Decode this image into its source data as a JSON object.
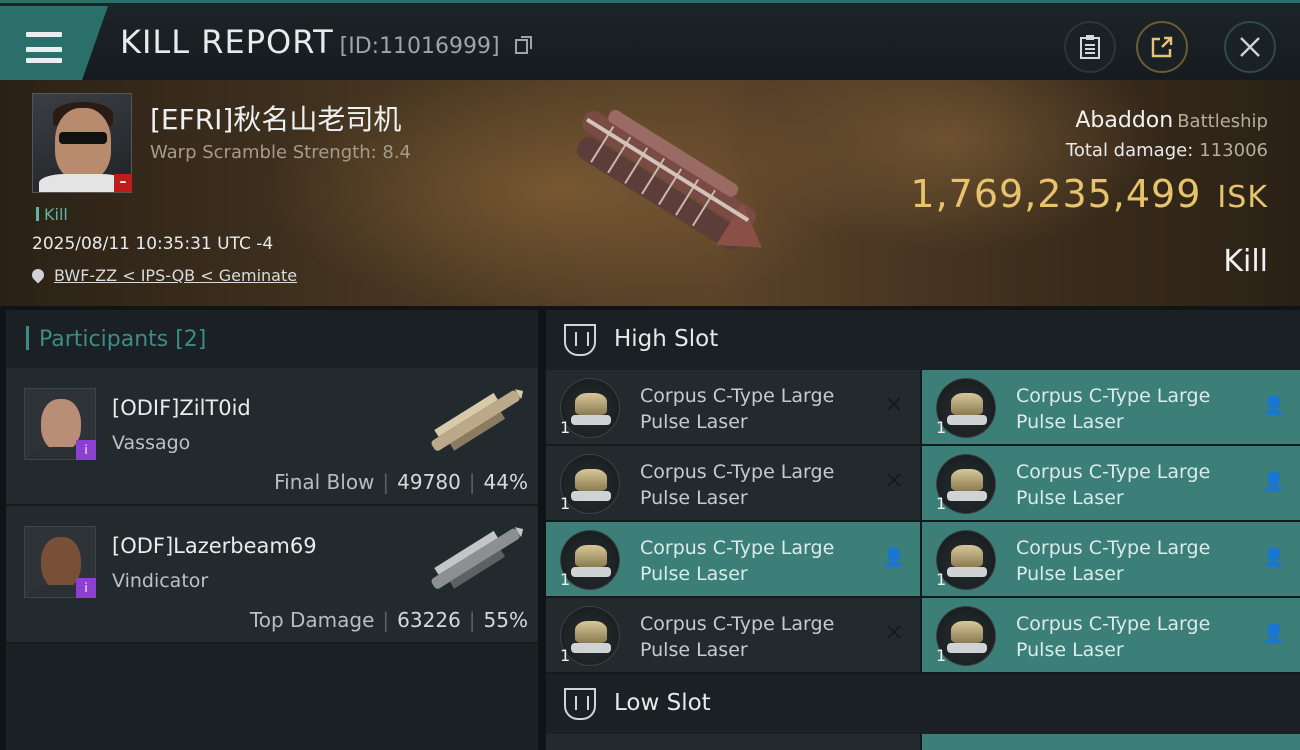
{
  "header": {
    "title": "KILL REPORT",
    "report_id": "[ID:11016999]",
    "icons": {
      "menu": "menu-icon",
      "copy": "copy-icon",
      "clipboard": "clipboard-icon",
      "share": "share-icon",
      "close": "close-icon"
    }
  },
  "victim": {
    "name": "[EFRI]秋名山老司机",
    "warp_scramble": "Warp Scramble Strength: 8.4",
    "tag": "Kill",
    "datetime": "2025/08/11 10:35:31 UTC -4",
    "location": "BWF-ZZ < IPS-QB < Geminate",
    "ship_name": "Abaddon",
    "ship_class": "Battleship",
    "total_damage_label": "Total damage:",
    "total_damage_value": "113006",
    "isk_value": "1,769,235,499",
    "isk_unit": "ISK",
    "result": "Kill"
  },
  "participants": {
    "title": "Participants [2]",
    "items": [
      {
        "name": "[ODIF]ZilT0id",
        "ship": "Vassago",
        "role": "Final Blow",
        "damage": "49780",
        "percent": "44%",
        "face_color": "#b88f76"
      },
      {
        "name": "[ODF]Lazerbeam69",
        "ship": "Vindicator",
        "role": "Top Damage",
        "damage": "63226",
        "percent": "55%",
        "face_color": "#7a4f38"
      }
    ]
  },
  "fitting": {
    "high_slot_title": "High Slot",
    "low_slot_title": "Low Slot",
    "high_modules": [
      {
        "line1": "Corpus C-Type Large",
        "line2": "Pulse Laser",
        "qty": "1",
        "fitted": false,
        "status": "✕"
      },
      {
        "line1": "Corpus C-Type Large",
        "line2": "Pulse Laser",
        "qty": "1",
        "fitted": true,
        "status": "👤"
      },
      {
        "line1": "Corpus C-Type Large",
        "line2": "Pulse Laser",
        "qty": "1",
        "fitted": false,
        "status": "✕"
      },
      {
        "line1": "Corpus C-Type Large",
        "line2": "Pulse Laser",
        "qty": "1",
        "fitted": true,
        "status": "👤"
      },
      {
        "line1": "Corpus C-Type Large",
        "line2": "Pulse Laser",
        "qty": "1",
        "fitted": true,
        "status": "👤"
      },
      {
        "line1": "Corpus C-Type Large",
        "line2": "Pulse Laser",
        "qty": "1",
        "fitted": true,
        "status": "👤"
      },
      {
        "line1": "Corpus C-Type Large",
        "line2": "Pulse Laser",
        "qty": "1",
        "fitted": false,
        "status": "✕"
      },
      {
        "line1": "Corpus C-Type Large",
        "line2": "Pulse Laser",
        "qty": "1",
        "fitted": true,
        "status": "👤"
      }
    ]
  }
}
